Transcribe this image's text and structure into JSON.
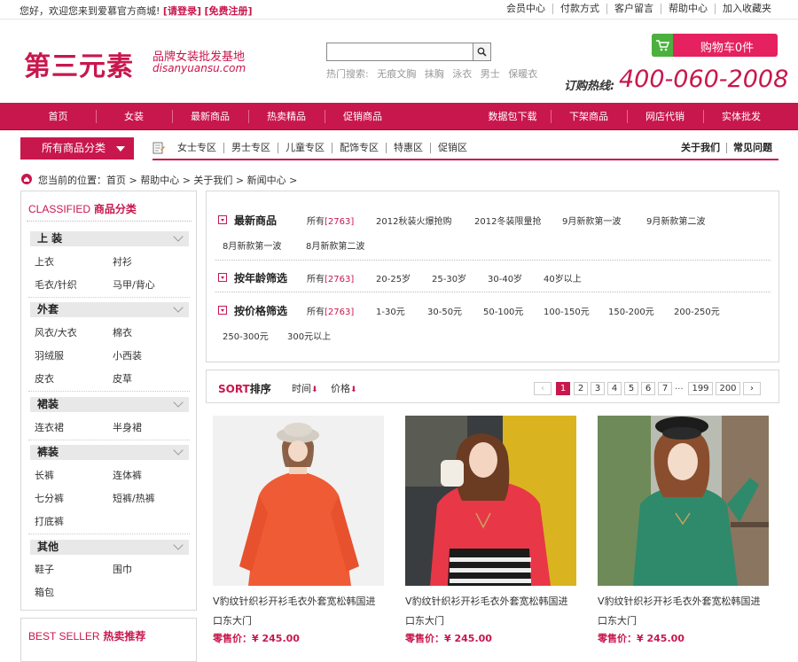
{
  "topbar": {
    "welcome": "您好，欢迎您来到爱慕官方商城!",
    "login": "[请登录]",
    "register": "[免费注册]",
    "links": [
      "会员中心",
      "付款方式",
      "客户留言",
      "帮助中心",
      "加入收藏夹"
    ]
  },
  "header": {
    "logo": "第三元素",
    "slogan": "品牌女装批发基地",
    "url": "disanyuansu.com",
    "search_placeholder": "",
    "hot_label": "热门搜索:",
    "hot_terms": [
      "无痕文胸",
      "抹胸",
      "泳衣",
      "男士",
      "保暖衣"
    ],
    "cart": "购物车0件",
    "hotline_label": "订购热线:",
    "hotline_number": "400-060-2008"
  },
  "mainnav": [
    "首页",
    "女装",
    "最新商品",
    "热卖精品",
    "促销商品",
    "数据包下载",
    "下架商品",
    "网店代销",
    "实体批发"
  ],
  "subnav": {
    "category_button": "所有商品分类",
    "zones": [
      "女士专区",
      "男士专区",
      "儿童专区",
      "配饰专区",
      "特惠区",
      "促销区"
    ],
    "right_links": [
      "关于我们",
      "常见问题"
    ]
  },
  "breadcrumb": "您当前的位置：首页 > 帮助中心 > 关于我们 > 新闻中心 >",
  "sidebar": {
    "title_en": "CLASSIFIED",
    "title_cn": "商品分类",
    "groups": [
      {
        "name": "上 装",
        "items": [
          "上衣",
          "衬衫",
          "毛衣/针织",
          "马甲/背心"
        ]
      },
      {
        "name": "外套",
        "items": [
          "风衣/大衣",
          "棉衣",
          "羽绒服",
          "小西装",
          "皮衣",
          "皮草"
        ]
      },
      {
        "name": "裙装",
        "items": [
          "连衣裙",
          "半身裙"
        ]
      },
      {
        "name": "裤装",
        "items": [
          "长裤",
          "连体裤",
          "七分裤",
          "短裤/热裤",
          "打底裤"
        ]
      },
      {
        "name": "其他",
        "items": [
          "鞋子",
          "围巾",
          "箱包"
        ]
      }
    ],
    "bestseller_en": "BEST SELLER",
    "bestseller_cn": "热卖推荐"
  },
  "filters": [
    {
      "label": "最新商品",
      "all": "所有",
      "count": "[2763]",
      "options": [
        "2012秋装火爆抢购",
        "2012冬装限量抢",
        "9月新款第一波",
        "9月新款第二波",
        "8月新款第一波",
        "8月新款第二波"
      ]
    },
    {
      "label": "按年龄筛选",
      "all": "所有",
      "count": "[2763]",
      "options": [
        "20-25岁",
        "25-30岁",
        "30-40岁",
        "40岁以上"
      ]
    },
    {
      "label": "按价格筛选",
      "all": "所有",
      "count": "[2763]",
      "options": [
        "1-30元",
        "30-50元",
        "50-100元",
        "100-150元",
        "150-200元",
        "200-250元",
        "250-300元",
        "300元以上"
      ]
    }
  ],
  "sort": {
    "title_en": "SORT",
    "title_cn": "排序",
    "options": [
      "时间",
      "价格"
    ],
    "arrow": "⬇",
    "pages": [
      "1",
      "2",
      "3",
      "4",
      "5",
      "6",
      "7",
      "...",
      "199",
      "200"
    ],
    "current_page": "1",
    "prev": "‹",
    "next": "›"
  },
  "products": [
    {
      "name": "V豹纹针织衫开衫毛衣外套宽松韩国进口东大门",
      "price_label": "零售价：",
      "price": "¥ 245.00"
    },
    {
      "name": "V豹纹针织衫开衫毛衣外套宽松韩国进口东大门",
      "price_label": "零售价：",
      "price": "¥ 245.00"
    },
    {
      "name": "V豹纹针织衫开衫毛衣外套宽松韩国进口东大门",
      "price_label": "零售价：",
      "price": "¥ 245.00"
    }
  ],
  "colors": {
    "accent": "#c8174d",
    "cart_green": "#4bb03e"
  }
}
